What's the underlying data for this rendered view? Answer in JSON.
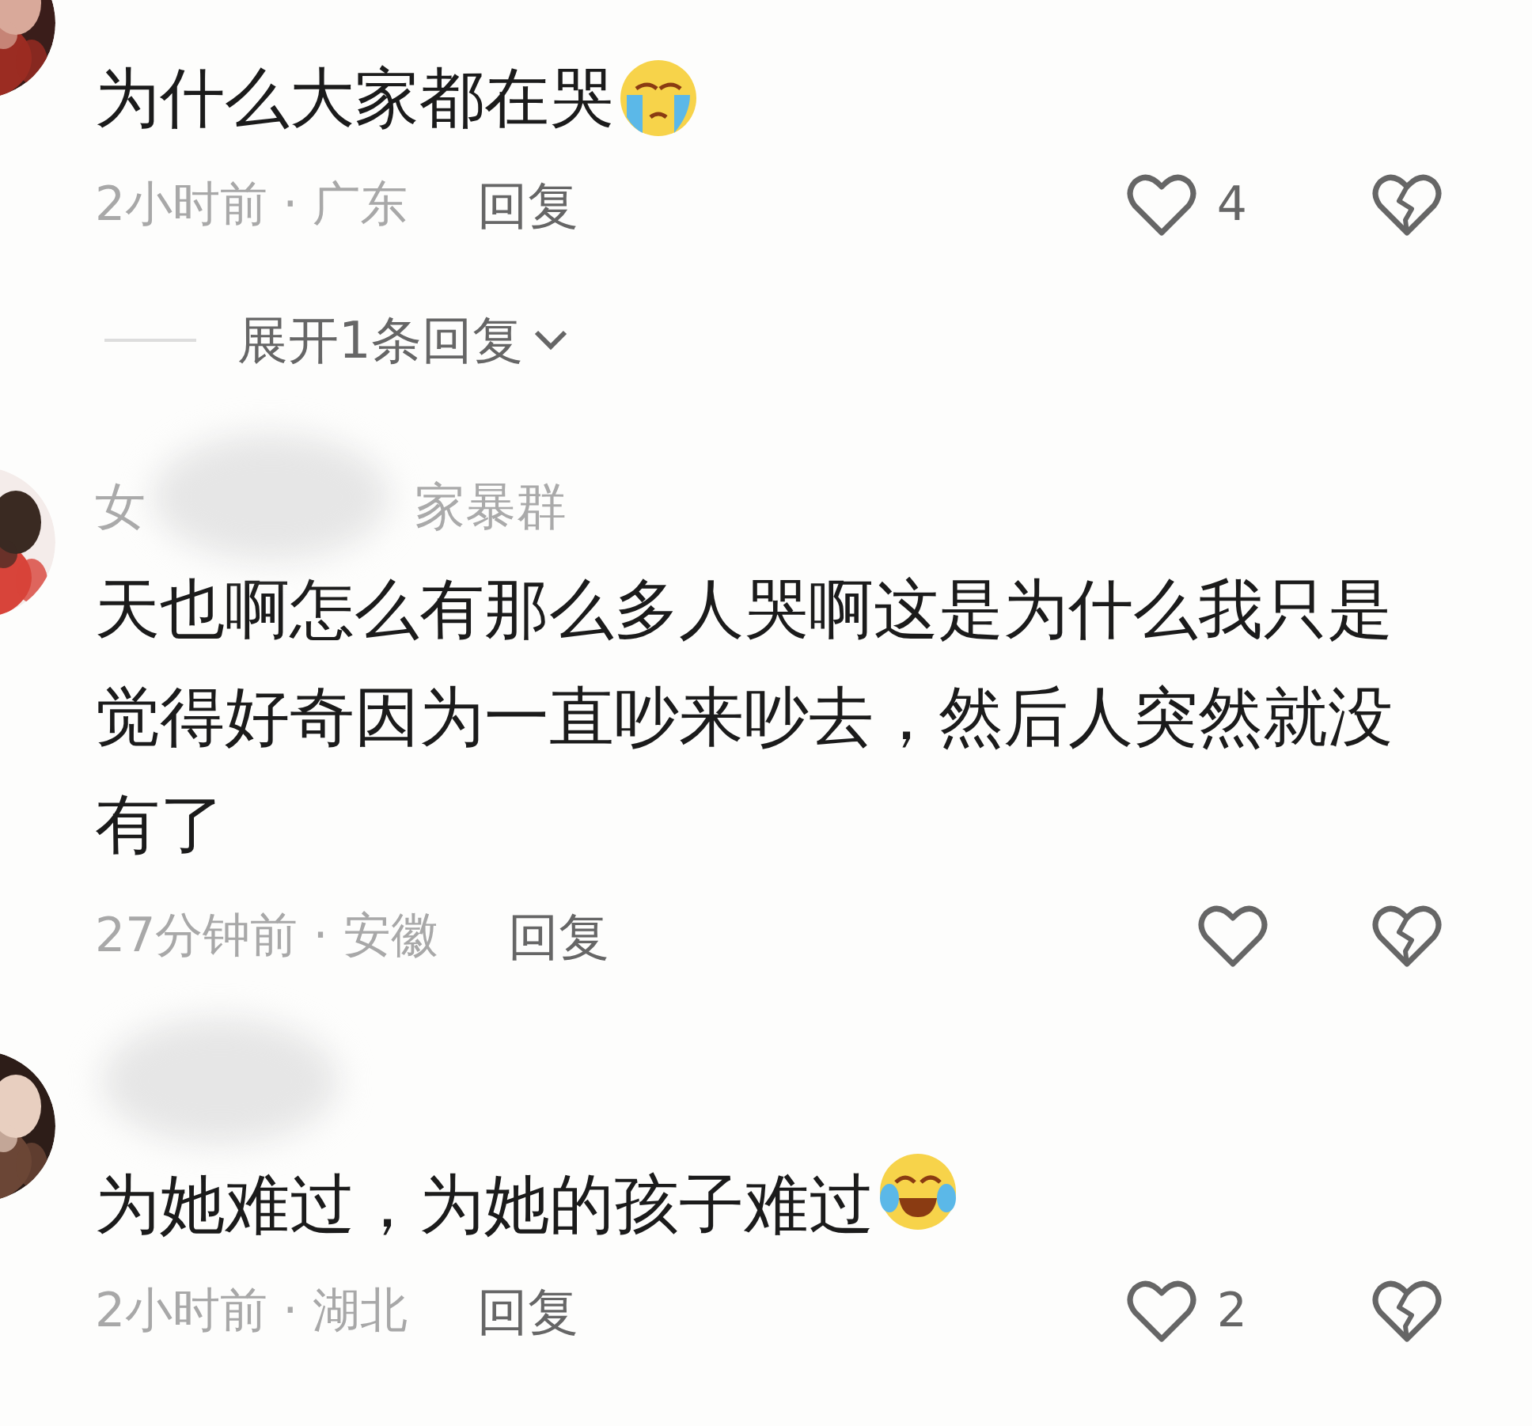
{
  "comments": [
    {
      "text": "为什么大家都在哭",
      "emoji": {
        "kind": "crying"
      },
      "time_location": "2小时前 · 广东",
      "reply_label": "回复",
      "like_count": "4",
      "expand_replies": "展开1条回复"
    },
    {
      "username_parts": [
        "女",
        "家暴群"
      ],
      "username_blurred": true,
      "text": "天也啊怎么有那么多人哭啊这是为什么我只是觉得好奇因为一直吵来吵去，然后人突然就没有了",
      "time_location": "27分钟前 · 安徽",
      "reply_label": "回复"
    },
    {
      "username_blurred": true,
      "text": "为她难过，为她的孩子难过",
      "emoji": {
        "kind": "tears_of_joy"
      },
      "time_location": "2小时前 · 湖北",
      "reply_label": "回复",
      "like_count": "2"
    }
  ]
}
